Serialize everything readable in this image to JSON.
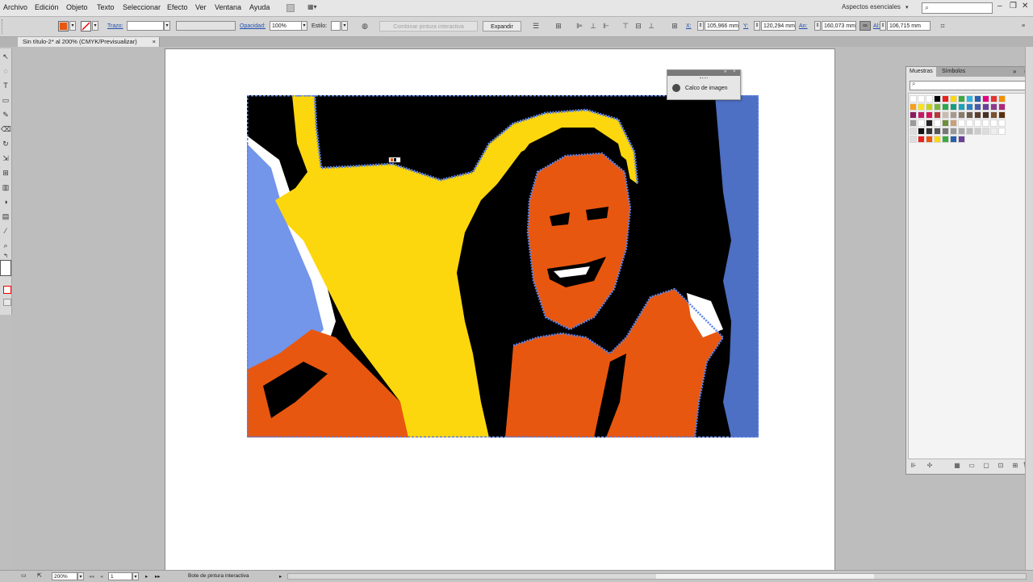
{
  "menu": {
    "items": [
      "Archivo",
      "Edición",
      "Objeto",
      "Texto",
      "Seleccionar",
      "Efecto",
      "Ver",
      "Ventana",
      "Ayuda"
    ],
    "workspace": "Aspectos esenciales",
    "search_placeholder": ""
  },
  "control": {
    "trazo_label": "Trazo:",
    "opacidad_label": "Opacidad:",
    "opacidad_value": "100%",
    "estilo_label": "Estilo:",
    "combine_button": "Combinar pintura interactiva",
    "expand_button": "Expandir",
    "x_label": "X:",
    "x_value": "105,966 mm",
    "y_label": "Y:",
    "y_value": "120,294 mm",
    "an_label": "An:",
    "an_value": "160,073 mm",
    "al_label": "Al:",
    "al_value": "106,715 mm",
    "fill_color": "#e8570f"
  },
  "document": {
    "tab_title": "Sin título-2* al 200% (CMYK/Previsualizar)",
    "close_glyph": "×"
  },
  "calco_panel": {
    "label": "Calco de imagen"
  },
  "swatches": {
    "tabs": [
      "Muestras",
      "Símbolos"
    ]
  },
  "status": {
    "zoom": "200%",
    "page": "1",
    "tool_text": "Bote de pintura interactiva"
  },
  "colors": {
    "black": "#000000",
    "yellow": "#fdd70d",
    "orange": "#e8570f",
    "trace_blue": "#5b82e6"
  },
  "icons": [
    "selection-tool-icon",
    "lasso-icon",
    "type-tool-icon",
    "rectangle-tool-icon",
    "brush-icon",
    "eraser-icon",
    "rotate-icon",
    "scale-icon",
    "mesh-icon",
    "gradient-icon",
    "blend-icon",
    "graph-icon",
    "eyedropper-icon",
    "zoom-icon",
    "swap-icon"
  ]
}
